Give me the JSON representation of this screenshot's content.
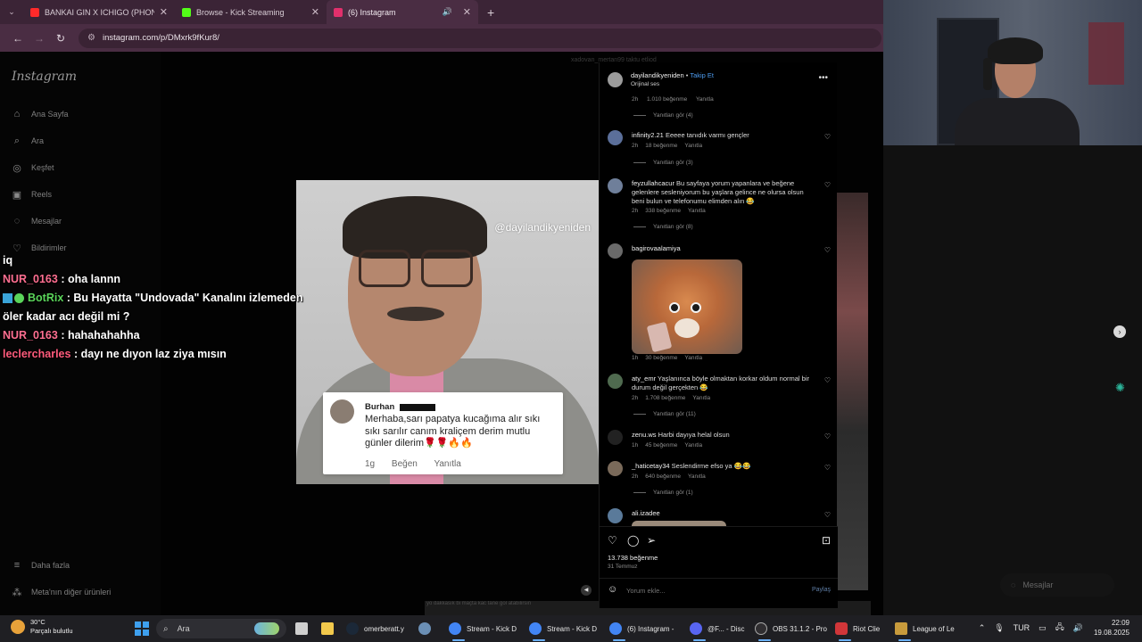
{
  "browser": {
    "tabs": [
      {
        "title": "BANKAI GIN X ICHIGO (PHONK",
        "icon": "youtube-icon",
        "color": "#ff2a2a"
      },
      {
        "title": "Browse - Kick Streaming",
        "icon": "kick-icon",
        "color": "#53fc18"
      },
      {
        "title": "(6) Instagram",
        "icon": "instagram-icon",
        "color": "#e1306c"
      }
    ],
    "url": "instagram.com/p/DMxrk9fKur8/"
  },
  "instagram": {
    "logo": "Instagram",
    "nav": [
      "Ana Sayfa",
      "Ara",
      "Keşfet",
      "Reels",
      "Mesajlar",
      "Bildirimler"
    ],
    "more": "Daha fazla",
    "meta": "Meta'nın diğer ürünleri",
    "top_caption": "xadovan_mertan99 taktu etliod",
    "watermark": "@dayilandikyeniden",
    "reply_card": {
      "name": "Burhan",
      "message": "Merhaba,sarı papatya kucağıma alır sıkı sıkı sarılır canım kraliçem derim mutlu günler dilerim🌹🌹🔥🔥",
      "time": "1g",
      "like": "Beğen",
      "reply": "Yanıtla"
    },
    "panel": {
      "author": "dayilandikyeniden",
      "follow": "Takip Et",
      "audio": "Orijinal ses",
      "first_meta": {
        "time": "2h",
        "likes": "1.010 beğenme",
        "reply": "Yanıtla"
      },
      "first_view": "Yanıtları gör (4)",
      "comments": [
        {
          "user": "infinity2.21",
          "text": "Eeeee tanıdık varmı gençler",
          "time": "2h",
          "likes": "18 beğenme",
          "reply": "Yanıtla",
          "view": "Yanıtları gör (3)"
        },
        {
          "user": "feyzullahcacur",
          "text": "Bu sayfaya yorum yapanlara ve beğene gelenlere sesleniyorum bu yaşlara gelince ne olursa olsun beni bulun ve telefonumu elimden alın 😂",
          "time": "2h",
          "likes": "338 beğenme",
          "reply": "Yanıtla",
          "view": "Yanıtları gör (8)"
        },
        {
          "user": "bagirovaalamiya",
          "text": "",
          "time": "1h",
          "likes": "30 beğenme",
          "reply": "Yanıtla",
          "view": ""
        },
        {
          "user": "aty_emr",
          "text": "Yaşlanınca böyle olmaktan korkar oldum normal bir durum değil gerçekten 😂",
          "time": "2h",
          "likes": "1.708 beğenme",
          "reply": "Yanıtla",
          "view": "Yanıtları gör (11)"
        },
        {
          "user": "zenu.ws",
          "text": "Harbi dayıya helal olsun",
          "time": "1h",
          "likes": "45 beğenme",
          "reply": "Yanıtla",
          "view": ""
        },
        {
          "user": "_haticetay34",
          "text": "Seslendirme efso ya 😂😂",
          "time": "2h",
          "likes": "640 beğenme",
          "reply": "Yanıtla",
          "view": "Yanıtları gör (1)"
        },
        {
          "user": "ali.izadee",
          "text": "",
          "time": "",
          "likes": "",
          "reply": "",
          "view": ""
        }
      ],
      "likes_total": "13.738 beğenme",
      "date": "31 Temmuz",
      "comment_placeholder": "Yorum ekle...",
      "share": "Paylaş"
    },
    "messages_pill": "Mesajlar",
    "bottom_caption": "yo dakkasık bi maçta kac tane gol atabilirsin"
  },
  "chat": [
    {
      "user": "",
      "text": "iq",
      "color": "#ffffff"
    },
    {
      "user": "NUR_0163",
      "text": ": oha lannn",
      "color": "#ff6f91"
    },
    {
      "user": "BotRix",
      "text": ": Bu Hayatta \"Undovada\" Kanalını izlemeden öler kadar acı değil mi ?",
      "color": "#5ad45a"
    },
    {
      "user": "NUR_0163",
      "text": ": hahahahahha",
      "color": "#ff6f91"
    },
    {
      "user": "leclercharles",
      "text": ": dayı ne dıyon laz ziya mısın",
      "color": "#ff5b7c"
    }
  ],
  "taskbar": {
    "weather_temp": "30°C",
    "weather_text": "Parçalı bulutlu",
    "search": "Ara",
    "items": [
      {
        "label": "omerberatt.y",
        "icon": "steam-icon",
        "color": "#1b2838"
      },
      {
        "label": "Stream - Kick D",
        "icon": "chrome-icon",
        "color": "#4285f4"
      },
      {
        "label": "Stream - Kick D",
        "icon": "chrome-icon",
        "color": "#4285f4"
      },
      {
        "label": "(6) Instagram -",
        "icon": "chrome-icon",
        "color": "#4285f4"
      },
      {
        "label": "@F... - Disc",
        "icon": "discord-icon",
        "color": "#5865f2"
      },
      {
        "label": "OBS 31.1.2 - Pro",
        "icon": "obs-icon",
        "color": "#302e31"
      },
      {
        "label": "Riot Clie",
        "icon": "riot-icon",
        "color": "#d13639"
      },
      {
        "label": "League of Le",
        "icon": "league-icon",
        "color": "#c89b3c"
      }
    ],
    "lang": "TUR",
    "time": "22:09",
    "date": "19.08.2025"
  }
}
